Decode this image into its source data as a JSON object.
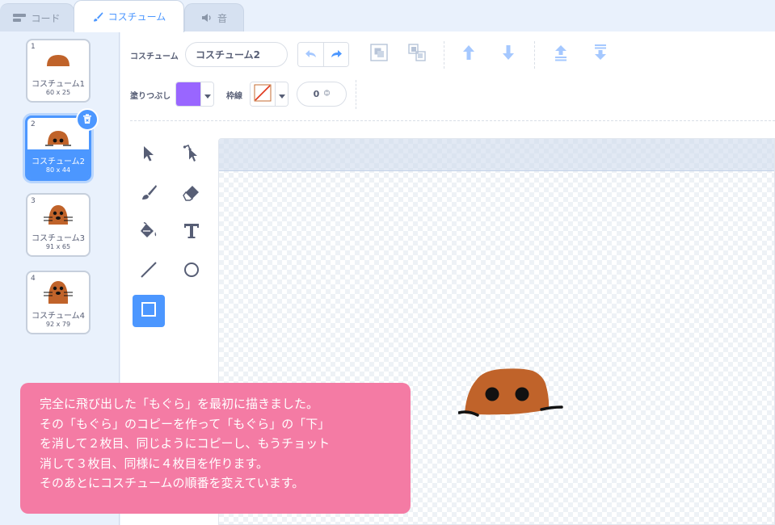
{
  "tabs": [
    {
      "label": "コード",
      "icon": "code-blocks-icon"
    },
    {
      "label": "コスチューム",
      "icon": "paintbrush-icon"
    },
    {
      "label": "音",
      "icon": "speaker-icon"
    }
  ],
  "costumes": [
    {
      "number": "1",
      "name": "コスチューム1",
      "size": "60 x 25"
    },
    {
      "number": "2",
      "name": "コスチューム2",
      "size": "80 x 44"
    },
    {
      "number": "3",
      "name": "コスチューム3",
      "size": "91 x 65"
    },
    {
      "number": "4",
      "name": "コスチューム4",
      "size": "92 x 79"
    }
  ],
  "selected_costume": "2",
  "toolbar": {
    "costume_label": "コスチューム",
    "costume_name": "コスチューム2",
    "fill_label": "塗りつぶし",
    "outline_label": "枠線",
    "outline_width": "0",
    "fill_color": "#9966ff"
  },
  "tools": [
    "select",
    "reshape",
    "brush",
    "eraser",
    "fill",
    "text",
    "line",
    "circle",
    "rectangle"
  ],
  "active_tool": "rectangle",
  "colors": {
    "accent": "#4c97ff",
    "mole": "#c0632a",
    "note": "#f47ba4"
  },
  "note": {
    "lines": [
      "完全に飛び出した「もぐら」を最初に描きました。",
      "その「もぐら」のコピーを作って「もぐら」の「下」",
      "を消して２枚目、同じようにコピーし、もうチョット",
      "消して３枚目、同様に４枚目を作ります。",
      "そのあとにコスチュームの順番を変えています。"
    ]
  }
}
